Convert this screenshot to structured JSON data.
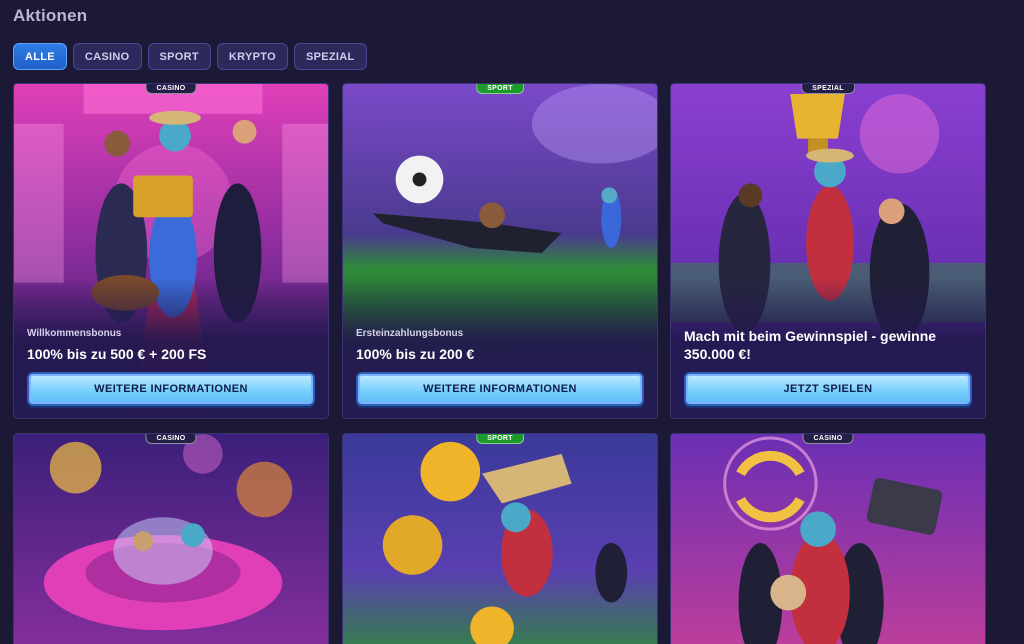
{
  "page": {
    "title": "Aktionen"
  },
  "filters": [
    {
      "label": "ALLE",
      "active": true
    },
    {
      "label": "CASINO",
      "active": false
    },
    {
      "label": "SPORT",
      "active": false
    },
    {
      "label": "KRYPTO",
      "active": false
    },
    {
      "label": "SPEZIAL",
      "active": false
    }
  ],
  "cards": [
    {
      "badge": "CASINO",
      "subtitle": "Willkommensbonus",
      "headline": "100% bis zu 500 € + 200 FS",
      "button": "WEITERE INFORMATIONEN"
    },
    {
      "badge": "SPORT",
      "subtitle": "Ersteinzahlungsbonus",
      "headline": "100% bis zu 200 €",
      "button": "WEITERE INFORMATIONEN"
    },
    {
      "badge": "SPEZIAL",
      "subtitle": "",
      "headline": "Mach mit beim Gewinnspiel - gewinne 350.000 €!",
      "button": "JETZT SPIELEN"
    },
    {
      "badge": "CASINO"
    },
    {
      "badge": "SPORT"
    },
    {
      "badge": "CASINO"
    }
  ],
  "colors": {
    "background": "#1b1936",
    "chip_active": "#2f7ee6",
    "cta_button": "#7ad1ff",
    "sport_badge": "#1d9a2c"
  }
}
